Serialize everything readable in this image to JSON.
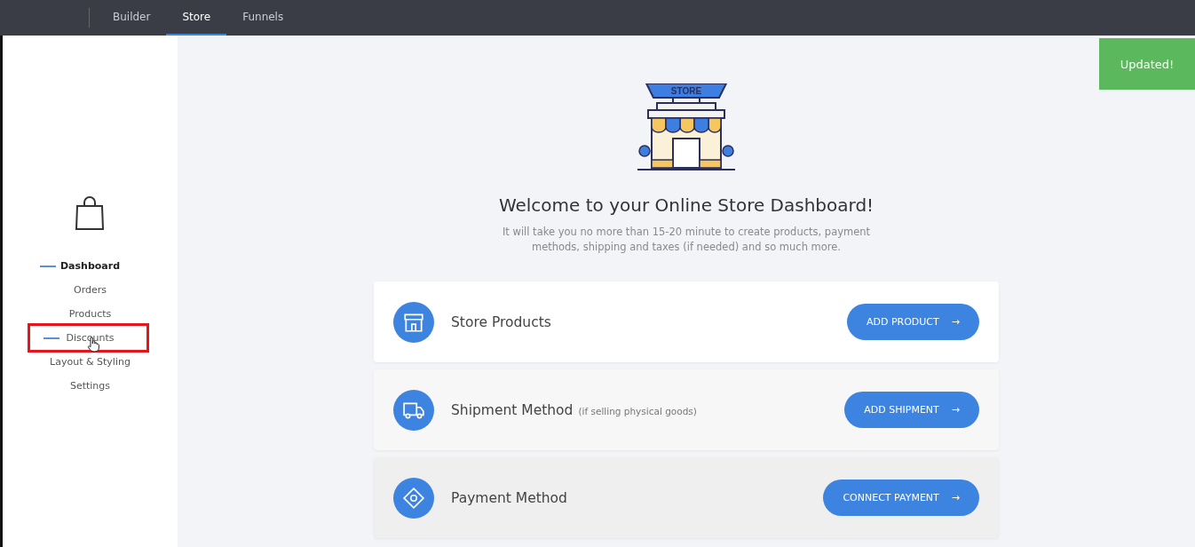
{
  "top_nav": {
    "tabs": [
      {
        "label": "Builder",
        "selected": false
      },
      {
        "label": "Store",
        "selected": true
      },
      {
        "label": "Funnels",
        "selected": false
      }
    ]
  },
  "sidebar": {
    "items": [
      {
        "label": "Dashboard",
        "selected": true,
        "hovered": false,
        "highlighted": false
      },
      {
        "label": "Orders",
        "selected": false,
        "hovered": false,
        "highlighted": false
      },
      {
        "label": "Products",
        "selected": false,
        "hovered": false,
        "highlighted": false
      },
      {
        "label": "Discounts",
        "selected": false,
        "hovered": true,
        "highlighted": true
      },
      {
        "label": "Layout & Styling",
        "selected": false,
        "hovered": false,
        "highlighted": false
      },
      {
        "label": "Settings",
        "selected": false,
        "hovered": false,
        "highlighted": false
      }
    ]
  },
  "toast": "Updated!",
  "hero": {
    "sign": "STORE",
    "title": "Welcome to your Online Store Dashboard!",
    "subtitle": "It will take you no more than 15-20 minute to create products, payment methods, shipping and taxes (if needed) and so much more."
  },
  "cards": [
    {
      "kind": "products",
      "title": "Store Products",
      "button": "ADD PRODUCT",
      "arrow": "→"
    },
    {
      "kind": "shipment",
      "title": "Shipment Method",
      "note": "(if selling physical goods)",
      "button": "ADD SHIPMENT",
      "arrow": "→"
    },
    {
      "kind": "payment",
      "title": "Payment Method",
      "button": "CONNECT PAYMENT",
      "arrow": "→"
    }
  ]
}
